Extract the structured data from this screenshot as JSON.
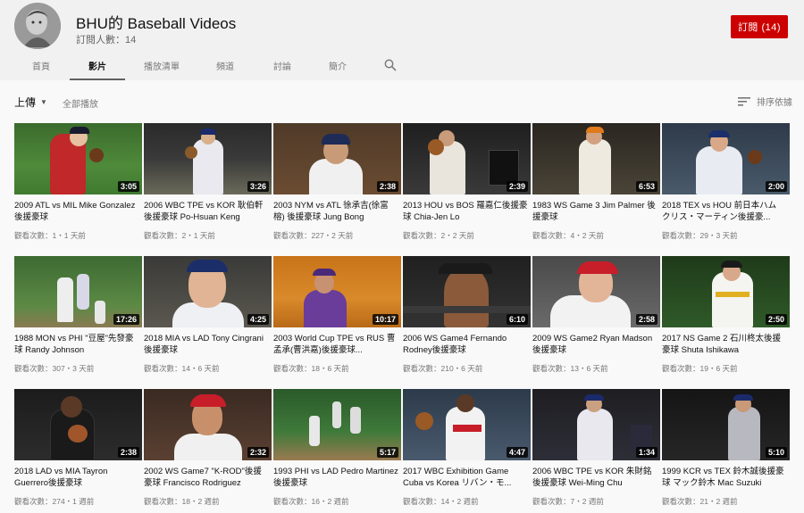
{
  "channel": {
    "title": "BHU的 Baseball Videos",
    "subscribers": "訂閱人數：14",
    "subscribe_label": "訂閱 (14)"
  },
  "tabs": [
    {
      "label": "首頁"
    },
    {
      "label": "影片"
    },
    {
      "label": "播放清單"
    },
    {
      "label": "頻道"
    },
    {
      "label": "討論"
    },
    {
      "label": "簡介"
    }
  ],
  "toolbar": {
    "uploads_label": "上傳",
    "play_all_label": "全部播放",
    "sort_label": "排序依據"
  },
  "videos": [
    {
      "title": "2009 ATL vs MIL Mike Gonzalez後援豪球",
      "meta": "觀看次數：1・1 天前",
      "duration": "3:05"
    },
    {
      "title": "2006 WBC TPE vs KOR 耿伯軒後援豪球 Po-Hsuan Keng",
      "meta": "觀看次數：2・1 天前",
      "duration": "3:26"
    },
    {
      "title": "2003 NYM vs ATL 徐承吉(徐富榕) 後援豪球 Jung Bong",
      "meta": "觀看次數：227・2 天前",
      "duration": "2:38"
    },
    {
      "title": "2013 HOU vs BOS 羅嘉仁後援豪球 Chia-Jen Lo",
      "meta": "觀看次數：2・2 天前",
      "duration": "2:39"
    },
    {
      "title": "1983 WS Game 3 Jim Palmer 後援豪球",
      "meta": "觀看次數：4・2 天前",
      "duration": "6:53"
    },
    {
      "title": "2018 TEX vs HOU 前日本ハム クリス・マーティン後援豪...",
      "meta": "觀看次數：29・3 天前",
      "duration": "2:00"
    },
    {
      "title": "1988 MON vs PHI \"豆屋\"先發豪球 Randy Johnson",
      "meta": "觀看次數：307・3 天前",
      "duration": "17:26"
    },
    {
      "title": "2018 MIA vs LAD Tony Cingrani後援豪球",
      "meta": "觀看次數：14・6 天前",
      "duration": "4:25"
    },
    {
      "title": "2003 World Cup TPE vs RUS 曹孟承(曹洪嘉)後援豪球...",
      "meta": "觀看次數：18・6 天前",
      "duration": "10:17"
    },
    {
      "title": "2006 WS Game4 Fernando Rodney後援豪球",
      "meta": "觀看次數：210・6 天前",
      "duration": "6:10"
    },
    {
      "title": "2009 WS Game2 Ryan Madson後援豪球",
      "meta": "觀看次數：13・6 天前",
      "duration": "2:58"
    },
    {
      "title": "2017 NS Game 2 石川柊太後援豪球 Shuta Ishikawa",
      "meta": "觀看次數：19・6 天前",
      "duration": "2:50"
    },
    {
      "title": "2018 LAD vs MIA Tayron Guerrero後援豪球",
      "meta": "觀看次數：274・1 週前",
      "duration": "2:38"
    },
    {
      "title": "2002 WS Game7 \"K-ROD\"後援豪球 Francisco Rodriguez",
      "meta": "觀看次數：18・2 週前",
      "duration": "2:32"
    },
    {
      "title": "1993 PHI vs LAD Pedro Martinez後援豪球",
      "meta": "觀看次數：16・2 週前",
      "duration": "5:17"
    },
    {
      "title": "2017 WBC Exhibition Game Cuba vs Korea リバン・モ...",
      "meta": "觀看次數：14・2 週前",
      "duration": "4:47"
    },
    {
      "title": "2006 WBC TPE vs KOR 朱財銘後援豪球 Wei-Ming Chu",
      "meta": "觀看次數：7・2 週前",
      "duration": "1:34"
    },
    {
      "title": "1999 KCR vs TEX 鈴木誠後援豪球 マック鈴木 Mac Suzuki",
      "meta": "觀看次數：21・2 週前",
      "duration": "5:10"
    }
  ],
  "colors": {
    "subscribe": "#cc0000",
    "header_bg": "#f1f1f1",
    "page_bg": "#f9f9f9"
  }
}
